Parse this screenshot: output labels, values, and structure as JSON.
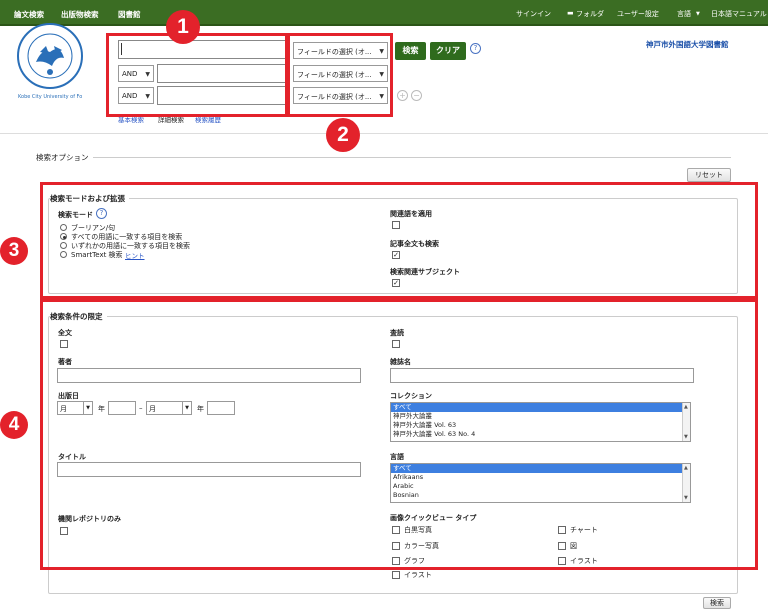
{
  "topnav": {
    "left": [
      "論文検索",
      "出版物検索",
      "図書館"
    ],
    "right": [
      "サインイン",
      "フォルダ",
      "ユーザー設定",
      "言語",
      "日本語マニュアル"
    ]
  },
  "logo": {
    "text": "Kobe City University of Foreign Studies"
  },
  "institution": "神戸市外国語大学図書館",
  "search": {
    "field_select": "フィールドの選択 (オ...",
    "bool": "AND",
    "search_button": "検索",
    "clear_button": "クリア",
    "help": "?",
    "links": [
      "基本検索",
      "詳細検索",
      "検索履歴"
    ],
    "add": "+",
    "remove": "−"
  },
  "badges": [
    "1",
    "2",
    "3",
    "4"
  ],
  "options": {
    "title": "検索オプション",
    "reset": "リセット",
    "mode_section": {
      "title": "検索モードおよび拡張",
      "mode_label": "検索モード",
      "modes": [
        "ブーリアン/句",
        "すべての用語に一致する項目を検索",
        "いずれかの用語に一致する項目を検索",
        "SmartText 検索"
      ],
      "hint": "ヒント",
      "related_words": "関連語を適用",
      "fulltext_search": "記事全文も検索",
      "related_subject": "検索関連サブジェクト"
    },
    "limit_section": {
      "title": "検索条件の限定",
      "fulltext": "全文",
      "peer_review": "査読",
      "author": "著者",
      "journal": "雑誌名",
      "pubdate": "出版日",
      "month": "月",
      "year": "年",
      "dash": "–",
      "collection": "コレクション",
      "collections": [
        "すべて",
        "神戸外大論叢",
        "神戸外大論叢 Vol. 63",
        "神戸外大論叢 Vol. 63 No. 4"
      ],
      "title_label": "タイトル",
      "language": "言語",
      "languages": [
        "すべて",
        "Afrikaans",
        "Arabic",
        "Bosnian"
      ],
      "repository": "機関レポジトリのみ",
      "image_types_label": "画像クイックビュー タイプ",
      "image_types_left": [
        "白黒写真",
        "カラー写真",
        "グラフ",
        "イラスト"
      ],
      "image_types_right": [
        "チャート",
        "図",
        "イラスト"
      ]
    },
    "bottom_search": "検索"
  }
}
